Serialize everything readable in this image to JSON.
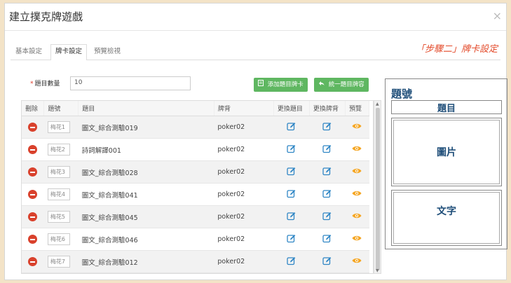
{
  "dialog": {
    "title": "建立撲克牌遊戲",
    "close_symbol": "×"
  },
  "tabs": [
    {
      "label": "基本設定",
      "active": false
    },
    {
      "label": "牌卡設定",
      "active": true
    },
    {
      "label": "預覽檢視",
      "active": false
    }
  ],
  "step_label": "「步驟二」牌卡設定",
  "form": {
    "required_mark": "*",
    "count_label": "題目數量",
    "count_value": "10"
  },
  "buttons": {
    "add_card": "添加題目牌卡",
    "unify_content": "統一題目牌容"
  },
  "table": {
    "headers": [
      "刪除",
      "題號",
      "題目",
      "牌背",
      "更換題目",
      "更換牌背",
      "預覽"
    ],
    "rows": [
      {
        "number": "梅花1",
        "topic": "圖文_綜合測驗019",
        "back": "poker02"
      },
      {
        "number": "梅花2",
        "topic": "詩詞解譯001",
        "back": "poker02"
      },
      {
        "number": "梅花3",
        "topic": "圖文_綜合測驗028",
        "back": "poker02"
      },
      {
        "number": "梅花4",
        "topic": "圖文_綜合測驗041",
        "back": "poker02"
      },
      {
        "number": "梅花5",
        "topic": "圖文_綜合測驗045",
        "back": "poker02"
      },
      {
        "number": "梅花6",
        "topic": "圖文_綜合測驗046",
        "back": "poker02"
      },
      {
        "number": "梅花7",
        "topic": "圖文_綜合測驗012",
        "back": "poker02"
      }
    ]
  },
  "card_preview": {
    "number_label": "題號",
    "topic_label": "題目",
    "image_label": "圖片",
    "text_label": "文字"
  },
  "colors": {
    "background": "#f3e3c7",
    "accent_green": "#5fb761",
    "delete_red": "#d9412c",
    "edit_blue": "#2f86c5",
    "eye_orange": "#f5a623",
    "step_red": "#e34a2a",
    "card_text": "#1f4e79"
  },
  "icons": {
    "delete": "minus-circle-icon",
    "edit": "pencil-square-icon",
    "preview": "eye-icon",
    "add": "document-icon",
    "unify": "reply-icon"
  }
}
